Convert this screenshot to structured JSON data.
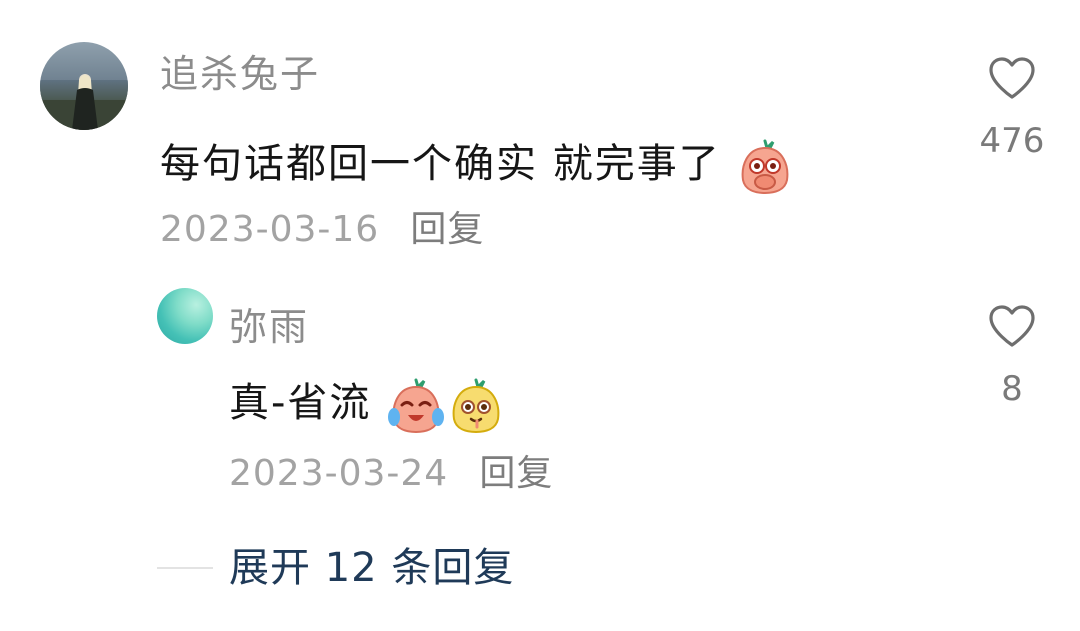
{
  "comment": {
    "username": "追杀兔子",
    "text": "每句话都回一个确实 就完事了",
    "emoji_icons": [
      "peach-covering-mouth-emoji"
    ],
    "date": "2023-03-16",
    "reply_label": "回复",
    "like_count": "476"
  },
  "reply": {
    "username": "弥雨",
    "text": "真-省流",
    "emoji_icons": [
      "peach-crying-laughing-emoji",
      "yellow-blob-drooling-emoji"
    ],
    "date": "2023-03-24",
    "reply_label": "回复",
    "like_count": "8"
  },
  "expand": {
    "label": "展开 12 条回复"
  },
  "colors": {
    "username": "#8c8c8c",
    "text": "#161616",
    "date": "#a3a3a3",
    "expand_link": "#1f3a58"
  }
}
